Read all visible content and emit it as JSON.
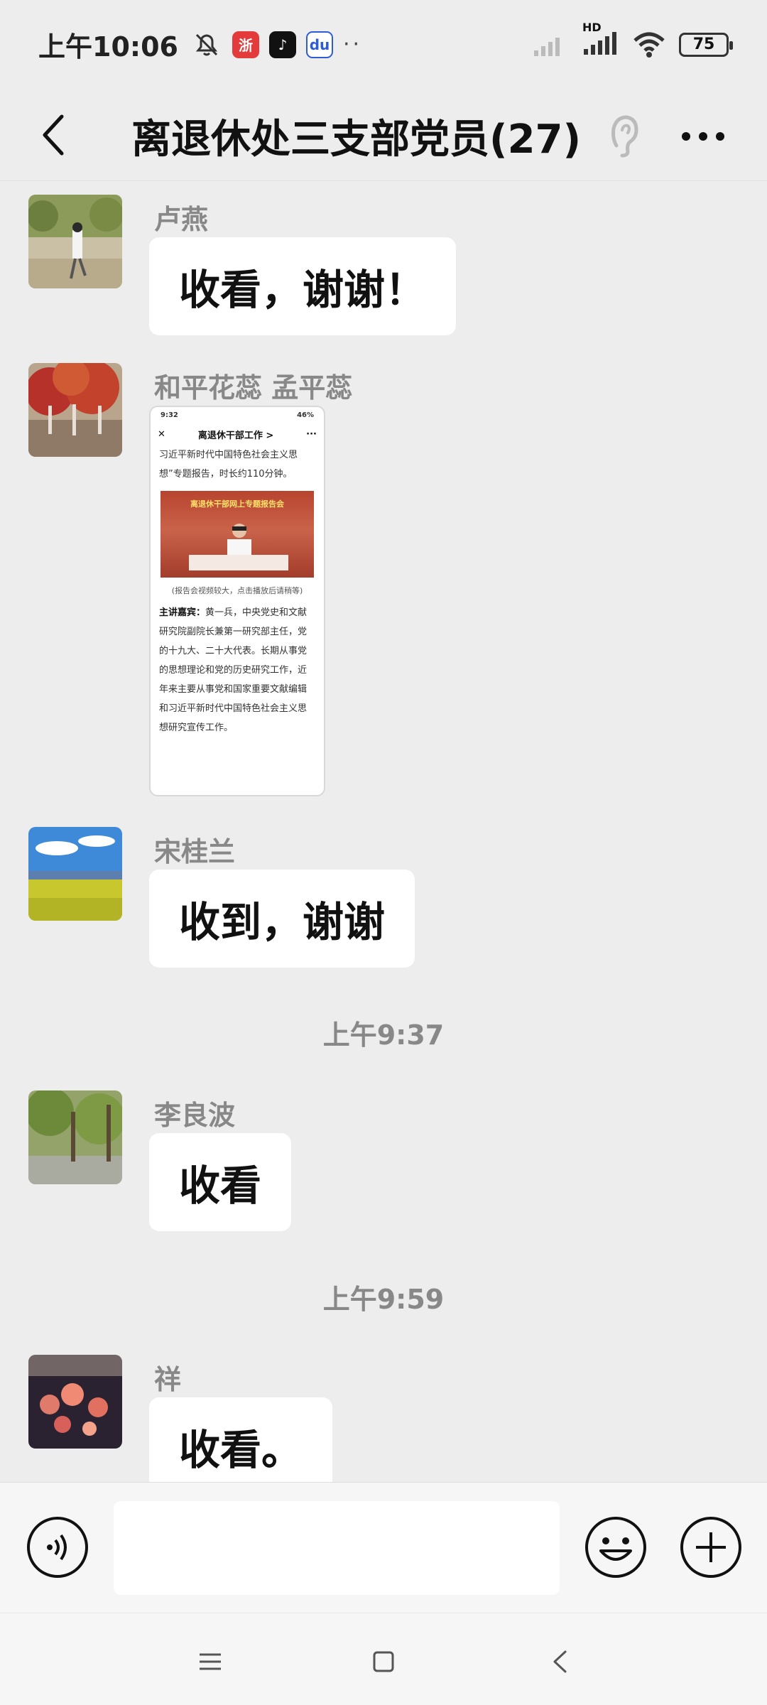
{
  "status_bar": {
    "time": "上午10:06",
    "battery": "75",
    "network": "HD"
  },
  "header": {
    "title": "离退休处三支部党员(27)"
  },
  "messages": [
    {
      "sender": "卢燕",
      "text": "收看，谢谢！"
    },
    {
      "sender": "和平花蕊  孟平蕊",
      "image": {
        "status_time": "9:32",
        "status_battery": "46%",
        "header_title": "离退休干部工作 >",
        "intro": "习近平新时代中国特色社会主义思想”专题报告，时长约110分钟。",
        "banner_title": "离退休干部网上专题报告会",
        "caption": "(报告会视频较大，点击播放后请稍等)",
        "body_label": "主讲嘉宾：",
        "body_text": "黄一兵，中央党史和文献研究院副院长兼第一研究部主任，党的十九大、二十大代表。长期从事党的思想理论和党的历史研究工作，近年来主要从事党和国家重要文献编辑和习近平新时代中国特色社会主义思想研究宣传工作。"
      }
    },
    {
      "sender": "宋桂兰",
      "text": "收到，谢谢"
    },
    {
      "timestamp": "上午9:37"
    },
    {
      "sender": "李良波",
      "text": "收看"
    },
    {
      "timestamp": "上午9:59"
    },
    {
      "sender": "祥",
      "text": "收看。"
    }
  ],
  "input": {
    "placeholder": ""
  },
  "colors": {
    "background": "#ededed",
    "bubble": "#ffffff",
    "name": "#888888"
  }
}
